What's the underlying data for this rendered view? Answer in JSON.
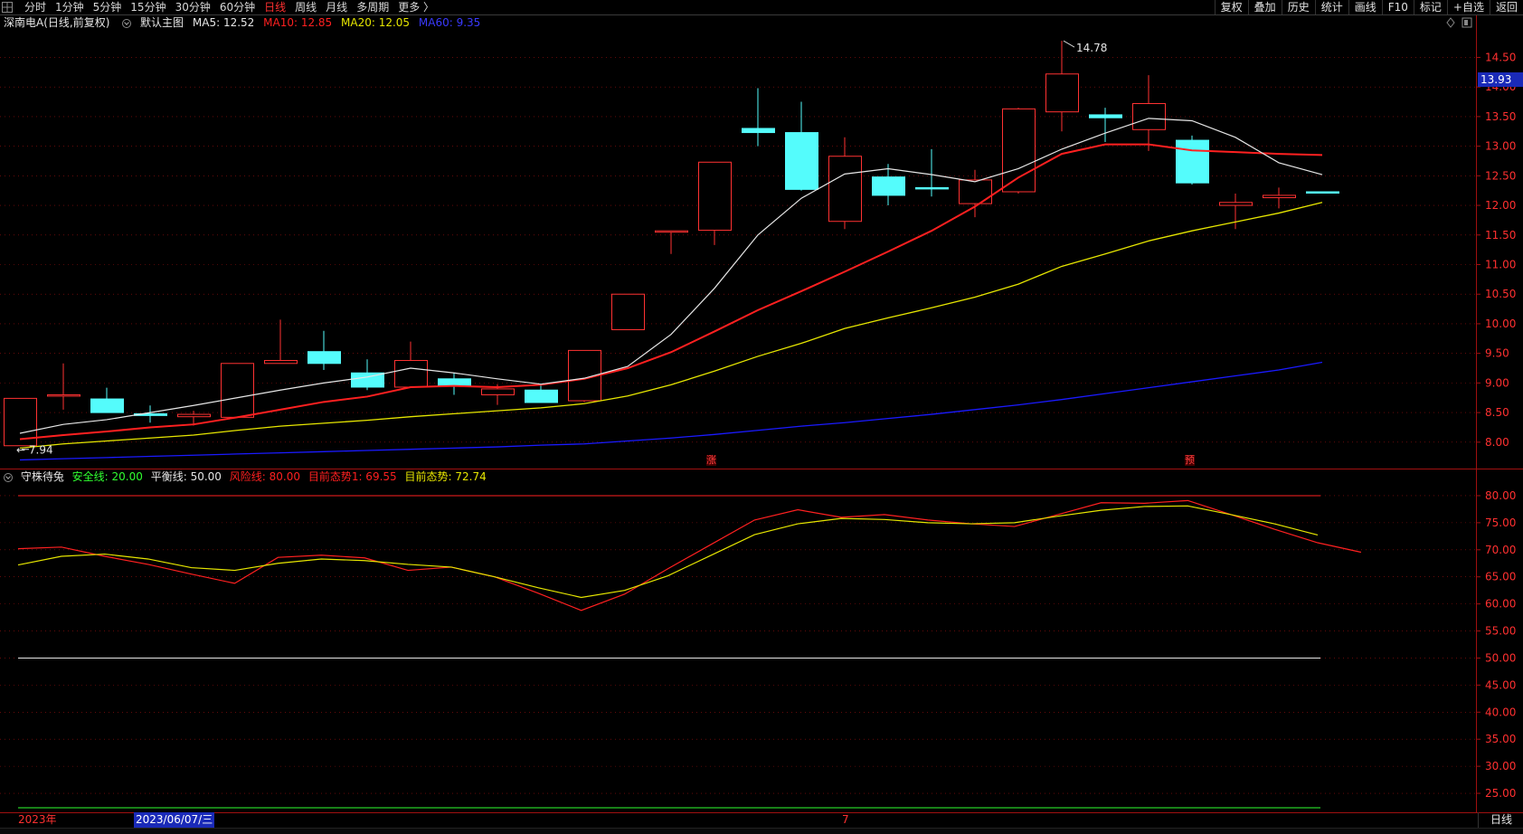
{
  "toolbar": {
    "periods": [
      "分时",
      "1分钟",
      "5分钟",
      "15分钟",
      "30分钟",
      "60分钟",
      "日线",
      "周线",
      "月线",
      "多周期",
      "更多 〉"
    ],
    "active_period": "日线",
    "tools": [
      "复权",
      "叠加",
      "历史",
      "统计",
      "画线",
      "F10",
      "标记",
      "+自选",
      "返回"
    ]
  },
  "main": {
    "stock_title": "深南电A(日线,前复权)",
    "template": "默认主图",
    "ma5": "MA5: 12.52",
    "ma10": "MA10: 12.85",
    "ma20": "MA20: 12.05",
    "ma60": "MA60: 9.35",
    "current_price_tag": "13.93",
    "high_label": "14.78",
    "low_label": "7.94",
    "marker_zhang": "涨",
    "marker_yu": "预",
    "y_ticks": [
      "14.50",
      "14.00",
      "13.50",
      "13.00",
      "12.50",
      "12.00",
      "11.50",
      "11.00",
      "10.50",
      "10.00",
      "9.50",
      "9.00",
      "8.50",
      "8.00"
    ]
  },
  "indicator": {
    "name": "守株待兔",
    "safe_line": "安全线: 20.00",
    "balance_line": "平衡线: 50.00",
    "risk_line": "风险线: 80.00",
    "trend1": "目前态势1: 69.55",
    "trend": "目前态势: 72.74",
    "y_ticks": [
      "80.00",
      "75.00",
      "70.00",
      "65.00",
      "60.00",
      "55.00",
      "50.00",
      "45.00",
      "40.00",
      "35.00",
      "30.00",
      "25.00"
    ]
  },
  "bottom": {
    "year": "2023年",
    "cursor_date": "2023/06/07/三",
    "month_mark": "7",
    "period_label": "日线"
  },
  "colors": {
    "up": "#ff3232",
    "down": "#54fcfc",
    "ma5": "#e6e6e6",
    "ma10": "#ff2020",
    "ma20": "#e6e600",
    "ma60": "#1a1aff",
    "axis_red": "#a01010"
  },
  "chart_data": {
    "type": "candlestick",
    "candles": [
      {
        "o": 8.74,
        "h": 8.74,
        "l": 7.94,
        "c": 7.94,
        "up": true
      },
      {
        "o": 8.78,
        "h": 9.33,
        "l": 8.55,
        "c": 8.8,
        "up": true
      },
      {
        "o": 8.5,
        "h": 8.92,
        "l": 8.5,
        "c": 8.73,
        "up": false
      },
      {
        "o": 8.45,
        "h": 8.62,
        "l": 8.33,
        "c": 8.48,
        "up": false
      },
      {
        "o": 8.43,
        "h": 8.53,
        "l": 8.28,
        "c": 8.47,
        "up": true
      },
      {
        "o": 8.42,
        "h": 9.33,
        "l": 8.41,
        "c": 9.33,
        "up": true
      },
      {
        "o": 9.33,
        "h": 10.07,
        "l": 9.33,
        "c": 9.38,
        "up": true
      },
      {
        "o": 9.53,
        "h": 9.88,
        "l": 9.22,
        "c": 9.33,
        "up": false
      },
      {
        "o": 9.17,
        "h": 9.4,
        "l": 8.88,
        "c": 8.93,
        "up": false
      },
      {
        "o": 8.93,
        "h": 9.7,
        "l": 8.93,
        "c": 9.38,
        "up": true
      },
      {
        "o": 9.07,
        "h": 9.17,
        "l": 8.8,
        "c": 8.95,
        "up": false
      },
      {
        "o": 8.8,
        "h": 8.98,
        "l": 8.63,
        "c": 8.9,
        "up": true
      },
      {
        "o": 8.88,
        "h": 8.98,
        "l": 8.67,
        "c": 8.67,
        "up": false
      },
      {
        "o": 8.7,
        "h": 9.55,
        "l": 8.68,
        "c": 9.55,
        "up": true
      },
      {
        "o": 9.9,
        "h": 10.5,
        "l": 9.9,
        "c": 10.5,
        "up": true
      },
      {
        "o": 11.57,
        "h": 11.57,
        "l": 11.18,
        "c": 11.57,
        "up": true
      },
      {
        "o": 11.58,
        "h": 12.73,
        "l": 11.33,
        "c": 12.73,
        "up": true
      },
      {
        "o": 13.3,
        "h": 13.98,
        "l": 13.0,
        "c": 13.23,
        "up": false
      },
      {
        "o": 13.23,
        "h": 13.75,
        "l": 12.25,
        "c": 12.27,
        "up": false
      },
      {
        "o": 11.73,
        "h": 13.15,
        "l": 11.6,
        "c": 12.83,
        "up": true
      },
      {
        "o": 12.48,
        "h": 12.7,
        "l": 12.0,
        "c": 12.17,
        "up": false
      },
      {
        "o": 12.3,
        "h": 12.95,
        "l": 12.15,
        "c": 12.28,
        "up": false
      },
      {
        "o": 12.03,
        "h": 12.6,
        "l": 11.8,
        "c": 12.43,
        "up": true
      },
      {
        "o": 12.23,
        "h": 13.65,
        "l": 12.2,
        "c": 13.63,
        "up": true
      },
      {
        "o": 13.58,
        "h": 14.78,
        "l": 13.25,
        "c": 14.22,
        "up": true
      },
      {
        "o": 13.53,
        "h": 13.65,
        "l": 13.07,
        "c": 13.48,
        "up": false
      },
      {
        "o": 13.28,
        "h": 14.2,
        "l": 12.92,
        "c": 13.72,
        "up": true
      },
      {
        "o": 13.1,
        "h": 13.18,
        "l": 12.35,
        "c": 12.38,
        "up": false
      },
      {
        "o": 12.0,
        "h": 12.2,
        "l": 11.6,
        "c": 12.05,
        "up": true
      },
      {
        "o": 12.13,
        "h": 12.3,
        "l": 11.95,
        "c": 12.17,
        "up": true
      },
      {
        "o": 12.23,
        "h": 12.23,
        "l": 12.23,
        "c": 12.23,
        "up": false
      }
    ],
    "ma5": [
      8.15,
      8.3,
      8.38,
      8.5,
      8.62,
      8.75,
      8.88,
      9.0,
      9.1,
      9.25,
      9.17,
      9.07,
      8.98,
      9.08,
      9.28,
      9.82,
      10.6,
      11.5,
      12.12,
      12.53,
      12.62,
      12.52,
      12.4,
      12.62,
      12.95,
      13.22,
      13.47,
      13.43,
      13.15,
      12.72,
      12.52
    ],
    "ma10": [
      8.05,
      8.12,
      8.18,
      8.25,
      8.3,
      8.42,
      8.55,
      8.68,
      8.77,
      8.93,
      8.95,
      8.93,
      8.97,
      9.07,
      9.25,
      9.52,
      9.87,
      10.23,
      10.55,
      10.88,
      11.22,
      11.57,
      11.98,
      12.47,
      12.87,
      13.03,
      13.03,
      12.93,
      12.9,
      12.87,
      12.85
    ],
    "ma20": [
      7.9,
      7.97,
      8.02,
      8.07,
      8.12,
      8.2,
      8.27,
      8.32,
      8.37,
      8.43,
      8.48,
      8.53,
      8.58,
      8.65,
      8.78,
      8.97,
      9.2,
      9.45,
      9.67,
      9.92,
      10.1,
      10.27,
      10.45,
      10.67,
      10.97,
      11.18,
      11.4,
      11.57,
      11.72,
      11.87,
      12.05
    ],
    "ma60": [
      7.7,
      7.72,
      7.74,
      7.76,
      7.78,
      7.8,
      7.82,
      7.84,
      7.86,
      7.88,
      7.9,
      7.92,
      7.95,
      7.97,
      8.02,
      8.07,
      8.13,
      8.2,
      8.27,
      8.33,
      8.4,
      8.47,
      8.55,
      8.63,
      8.72,
      8.82,
      8.92,
      9.02,
      9.12,
      9.22,
      9.35
    ],
    "price_range": [
      7.6,
      14.95
    ],
    "indicator_trend1": [
      70.2,
      70.5,
      68.8,
      67.3,
      65.5,
      63.8,
      68.6,
      69.0,
      68.5,
      66.2,
      66.8,
      65.0,
      62.0,
      58.8,
      61.8,
      66.5,
      71.0,
      75.5,
      77.4,
      76.0,
      76.5,
      75.5,
      74.8,
      74.3,
      76.5,
      78.7,
      78.6,
      79.1,
      76.5,
      73.8,
      71.3,
      69.55
    ],
    "indicator_trend": [
      67.2,
      68.8,
      69.2,
      68.3,
      66.7,
      66.2,
      67.5,
      68.3,
      68.0,
      67.3,
      66.8,
      65.0,
      63.0,
      61.2,
      62.5,
      65.2,
      69.0,
      72.8,
      74.8,
      75.8,
      75.6,
      75.0,
      74.8,
      75.0,
      76.2,
      77.3,
      78.0,
      78.1,
      76.5,
      74.8,
      72.74
    ],
    "indicator_range": [
      22.0,
      82.0
    ],
    "safe_value": 20.0,
    "balance_value": 50.0,
    "risk_value": 80.0
  }
}
